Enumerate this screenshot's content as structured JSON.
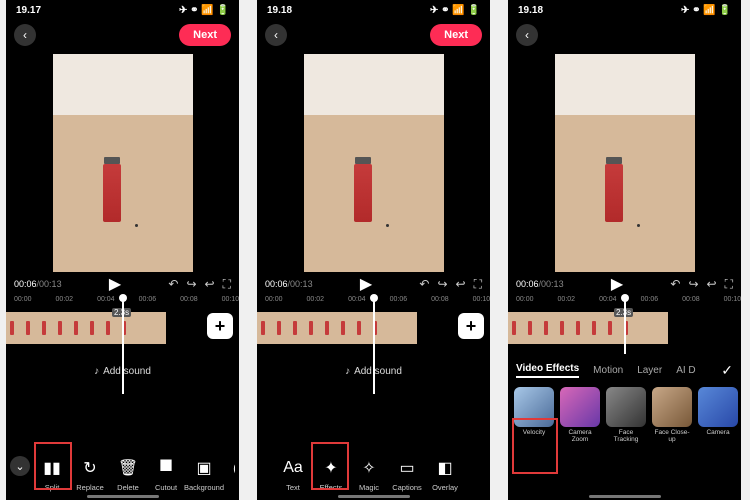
{
  "screens": [
    {
      "time": "19.17",
      "next": "Next",
      "cur_time": "00:06",
      "total_time": "00:13",
      "ruler": [
        "00:00",
        "00:02",
        "00:04",
        "00:06",
        "00:08",
        "00:10"
      ],
      "clip_len": "2.3s",
      "addsound": "Add sound",
      "tools": [
        "Split",
        "Replace",
        "Delete",
        "Cutout",
        "Background",
        "Sp"
      ]
    },
    {
      "time": "19.18",
      "next": "Next",
      "cur_time": "00:06",
      "total_time": "00:13",
      "ruler": [
        "00:00",
        "00:02",
        "00:04",
        "00:06",
        "00:08",
        "00:10"
      ],
      "addsound": "Add sound",
      "tools": [
        "Text",
        "Effects",
        "Magic",
        "Captions",
        "Overlay"
      ]
    },
    {
      "time": "19.18",
      "cur_time": "00:06",
      "total_time": "00:13",
      "ruler": [
        "00:00",
        "00:02",
        "00:04",
        "00:06",
        "00:08",
        "00:10"
      ],
      "clip_len": "2.3s",
      "fx_tabs": [
        "Video Effects",
        "Motion",
        "Layer",
        "AI D"
      ],
      "fx_items": [
        "Velocity",
        "Camera Zoom",
        "Face Tracking",
        "Face Close-up",
        "Camera"
      ]
    }
  ],
  "icons": {
    "back": "‹",
    "play": "▶",
    "rotate": "↶",
    "undo": "↪",
    "redo": "↩",
    "full": "⛶",
    "plus": "+",
    "collapse": "⌄",
    "note": "♪",
    "check": "✓"
  },
  "tool_icons": {
    "Split": "▮▮",
    "Replace": "↻",
    "Delete": "🗑",
    "Cutout": "⯀",
    "Background": "▣",
    "Sp": "◯",
    "Text": "Aa",
    "Effects": "✦",
    "Magic": "✧",
    "Captions": "▭",
    "Overlay": "◧"
  }
}
